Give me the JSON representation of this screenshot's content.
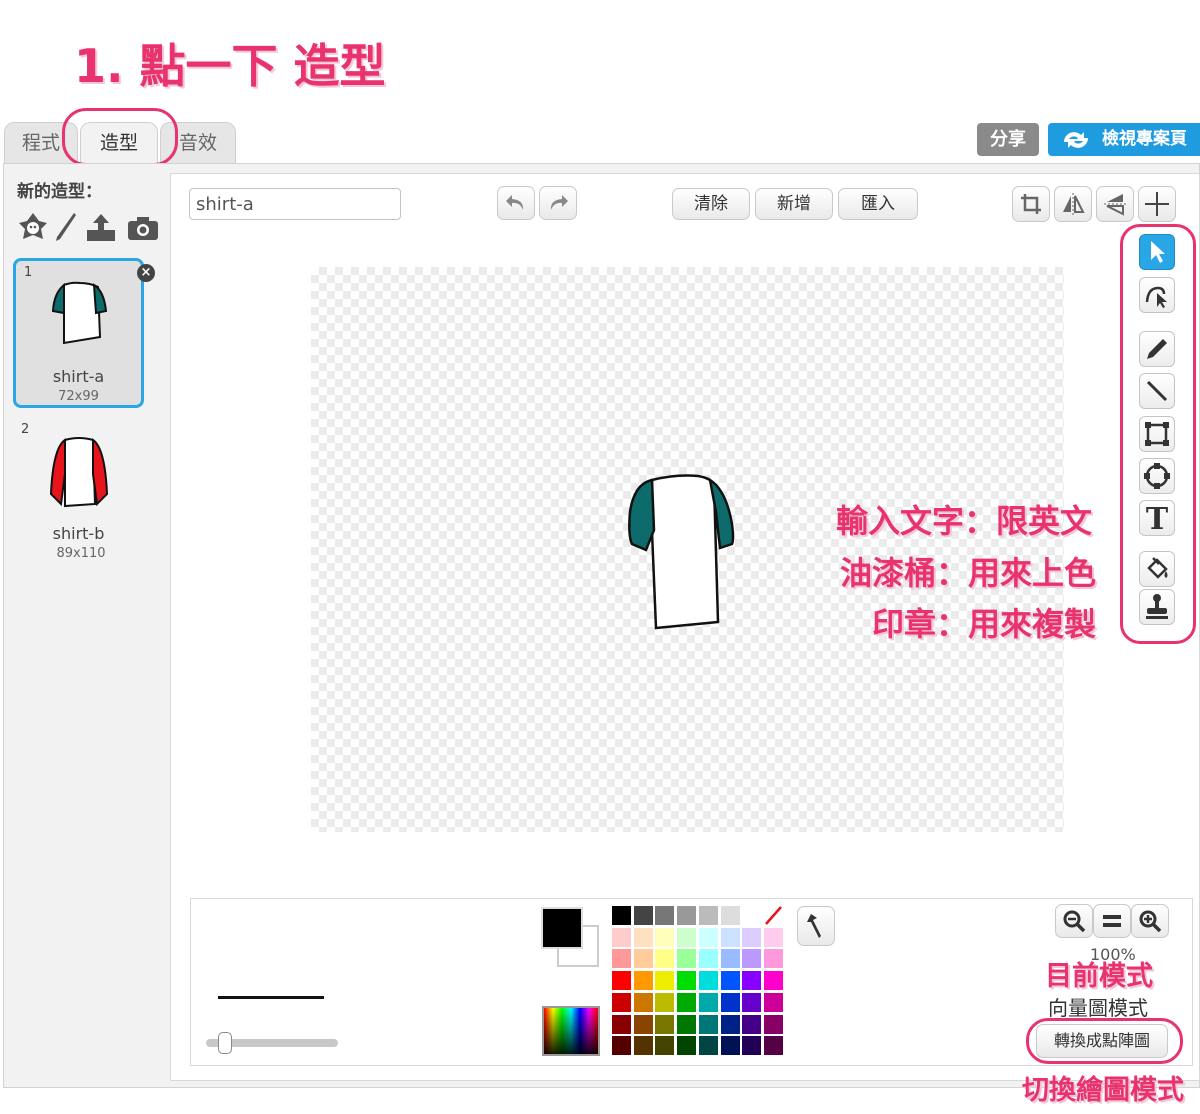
{
  "annotations": {
    "step1": "1. 點一下 造型",
    "text_tool": "輸入文字：限英文",
    "fill_tool": "油漆桶：用來上色",
    "stamp_tool": "印章：用來複製",
    "current_mode": "目前模式",
    "switch_mode": "切換繪圖模式"
  },
  "tabs": [
    {
      "label": "程式"
    },
    {
      "label": "造型"
    },
    {
      "label": "音效"
    }
  ],
  "header": {
    "share_label": "分享",
    "project_page_label": "檢視專案頁"
  },
  "sidebar": {
    "new_costume_label": "新的造型：",
    "costumes": [
      {
        "index": "1",
        "name": "shirt-a",
        "size": "72x99"
      },
      {
        "index": "2",
        "name": "shirt-b",
        "size": "89x110"
      }
    ]
  },
  "editor": {
    "costume_name_value": "shirt-a",
    "clear_label": "清除",
    "add_label": "新增",
    "import_label": "匯入",
    "zoom_value": "100%",
    "mode_label": "向量圖模式",
    "convert_label": "轉換成點陣圖"
  },
  "colors": {
    "accent": "#e8336e",
    "selected_tool": "#29a6e6",
    "shirt_sleeve_a": "#0e6b6b",
    "shirt_sleeve_b": "#e8141c",
    "palette": [
      [
        "#000000",
        "#444444",
        "#777777",
        "#999999",
        "#bbbbbb",
        "#dddddd",
        "#ffffff",
        "none"
      ],
      [
        "#ffcccc",
        "#ffe0c0",
        "#ffffbb",
        "#ccffcc",
        "#ccffff",
        "#cce0ff",
        "#ddccff",
        "#ffccee"
      ],
      [
        "#ff9999",
        "#ffcc99",
        "#ffff88",
        "#99ff99",
        "#99ffff",
        "#99bbff",
        "#bb99ff",
        "#ff99dd"
      ],
      [
        "#ff0000",
        "#ff9900",
        "#eeee00",
        "#00dd00",
        "#00dddd",
        "#0055ff",
        "#8800ff",
        "#ff00cc"
      ],
      [
        "#cc0000",
        "#cc7700",
        "#bbbb00",
        "#00aa00",
        "#00aaaa",
        "#0033cc",
        "#6600cc",
        "#cc0099"
      ],
      [
        "#880000",
        "#884400",
        "#777700",
        "#007700",
        "#007777",
        "#002288",
        "#440088",
        "#880066"
      ],
      [
        "#550000",
        "#553300",
        "#444400",
        "#004400",
        "#004444",
        "#001155",
        "#220055",
        "#550044"
      ]
    ]
  }
}
